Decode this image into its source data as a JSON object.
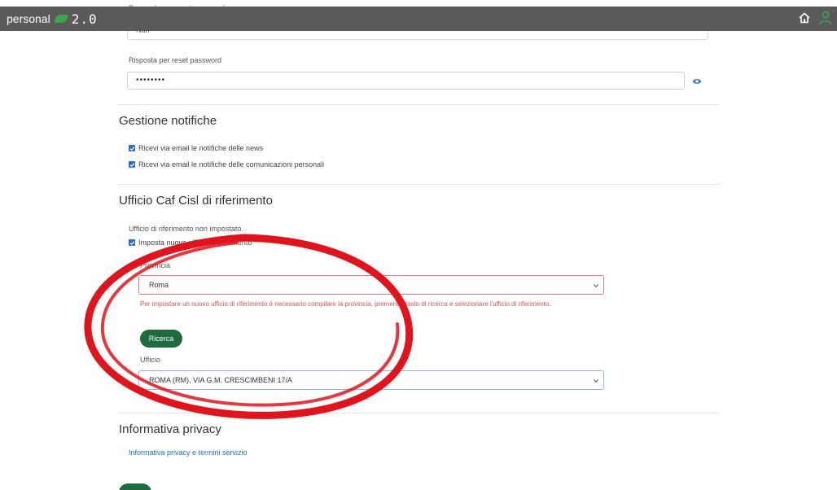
{
  "navbar": {
    "brand": "personal",
    "version": "2.0"
  },
  "security": {
    "question_label": "Domanda per reset password",
    "question_value": "Nan",
    "answer_label": "Risposta per reset password",
    "answer_value": "••••••••"
  },
  "notifications": {
    "title": "Gestione notifiche",
    "items": [
      {
        "label": "Ricevi via email le notifiche delle news",
        "checked": true
      },
      {
        "label": "Ricevi via email le notifiche delle comunicazioni personali",
        "checked": true
      }
    ]
  },
  "office": {
    "title": "Ufficio Caf Cisl di riferimento",
    "status_text": "Ufficio di riferimento non impostato.",
    "set_new_label": "Imposta nuovo ufficio di riferimento",
    "province_label": "Provincia",
    "province_value": "Roma",
    "error_text": "Per impostare un nuovo ufficio di riferimento è necessario compilare la provincia, premere il tasto di ricerca e selezionare l'ufficio di riferimento.",
    "search_button": "Ricerca",
    "office_label": "Ufficio",
    "office_value": "ROMA (RM), VIA G.M. CRESCIMBENI 17/A"
  },
  "privacy": {
    "title": "Informativa privacy",
    "link": "Informativa privacy e termini servizio"
  },
  "colors": {
    "navbar": "#5a5a5a",
    "primary_green": "#1e6b3e",
    "error_red": "#d9534f",
    "annotation_red": "#e0141c",
    "link_blue": "#1a73c9"
  }
}
